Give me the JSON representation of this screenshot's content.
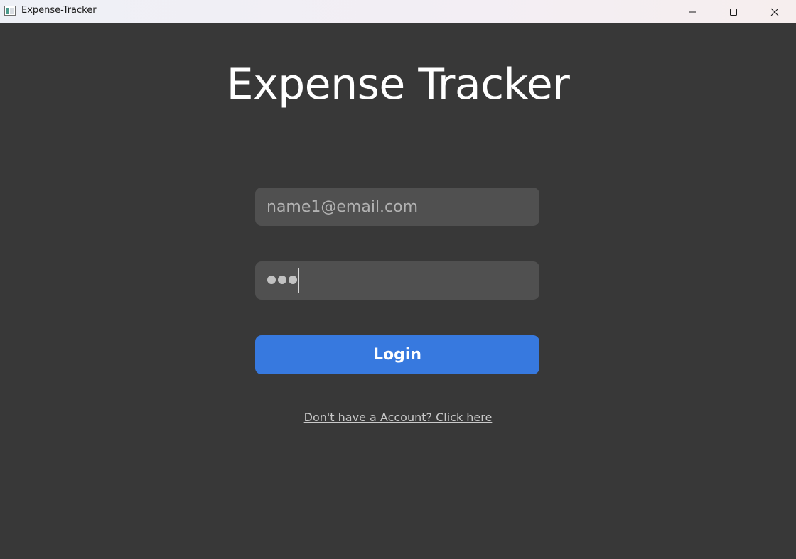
{
  "window": {
    "title": "Expense-Tracker",
    "controls": {
      "minimize_icon": "minimize-icon",
      "maximize_icon": "maximize-icon",
      "close_icon": "close-icon"
    }
  },
  "main": {
    "heading": "Expense Tracker",
    "email_field": {
      "value": "",
      "placeholder": "name1@email.com"
    },
    "password_field": {
      "masked_length": 3
    },
    "login_button": {
      "label": "Login"
    },
    "signup_link": {
      "label": "Don't have a Account? Click here"
    }
  },
  "colors": {
    "background": "#383838",
    "field": "#505050",
    "accent": "#3779df",
    "heading_text": "#ffffff"
  }
}
